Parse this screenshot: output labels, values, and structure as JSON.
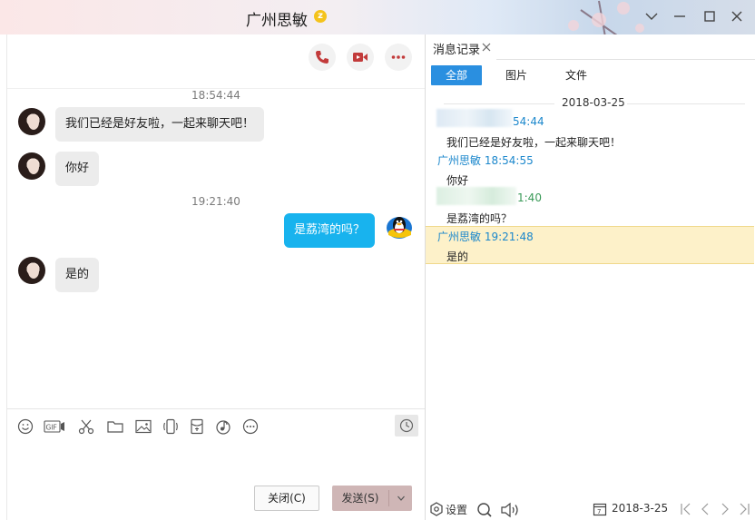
{
  "window": {
    "title": "广州思敏",
    "badge": "z",
    "accent": "#18b3ee"
  },
  "window_controls": [
    "chevron-down-icon",
    "minimize-icon",
    "maximize-icon",
    "close-icon"
  ],
  "chat": {
    "header_actions": [
      "phone-icon",
      "video-call-icon",
      "more-icon"
    ],
    "messages": [
      {
        "type": "timestamp",
        "text": "18:54:44"
      },
      {
        "type": "incoming",
        "text": "我们已经是好友啦，一起来聊天吧！"
      },
      {
        "type": "incoming",
        "text": "你好"
      },
      {
        "type": "timestamp",
        "text": "19:21:40"
      },
      {
        "type": "outgoing",
        "text": "是荔湾的吗？"
      },
      {
        "type": "incoming",
        "text": "是的"
      }
    ],
    "toolbar_icons": [
      "emoji-icon",
      "gif-icon",
      "scissors-icon",
      "folder-icon",
      "image-icon",
      "shake-icon",
      "red-packet-icon",
      "music-icon",
      "more-icon",
      "clock-icon"
    ],
    "gif_label": "GIF",
    "close_button": "关闭(C)",
    "send_button": "发送(S)"
  },
  "history": {
    "tab_title": "消息记录",
    "filters": [
      "全部",
      "图片",
      "文件"
    ],
    "active_filter": "全部",
    "date": "2018-03-25",
    "entries": [
      {
        "sender": "",
        "time_partial": "54:44",
        "message": "我们已经是好友啦，一起来聊天吧！"
      },
      {
        "sender": "广州思敏 18:54:55",
        "message": "你好"
      },
      {
        "sender": "",
        "time_partial": "1:40",
        "message": "是荔湾的吗？"
      },
      {
        "sender": "广州思敏 19:21:48",
        "message": "是的"
      }
    ],
    "settings_label": "设置",
    "bottom_date": "2018-3-25"
  }
}
